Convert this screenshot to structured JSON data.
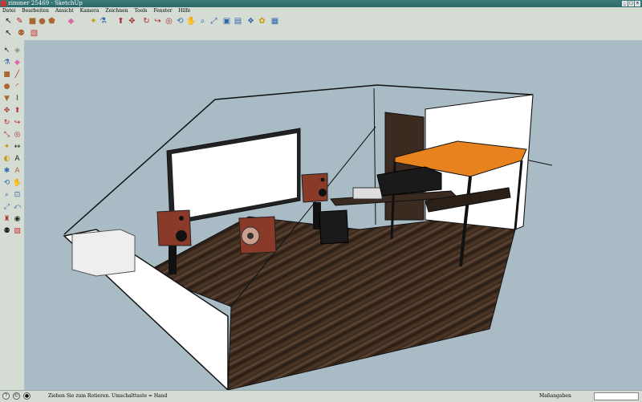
{
  "window": {
    "title": "zimmer 25469 - SketchUp"
  },
  "window_buttons": [
    "_",
    "□",
    "×"
  ],
  "menu": [
    "Datei",
    "Bearbeiten",
    "Ansicht",
    "Kamera",
    "Zeichnen",
    "Tools",
    "Fenster",
    "Hilfe"
  ],
  "toolbar_icons": [
    {
      "name": "select-icon",
      "glyph": "↖",
      "color": "#222"
    },
    {
      "name": "pencil-icon",
      "glyph": "✎",
      "color": "#b22"
    },
    {
      "name": "rectangle-icon",
      "glyph": "■",
      "color": "#a63"
    },
    {
      "name": "circle-icon",
      "glyph": "●",
      "color": "#a63"
    },
    {
      "name": "polygon-icon",
      "glyph": "⬟",
      "color": "#a63"
    },
    {
      "name": "eraser-icon",
      "glyph": "◆",
      "color": "#d6a"
    },
    {
      "name": "tape-measure-icon",
      "glyph": "✦",
      "color": "#c90"
    },
    {
      "name": "paint-bucket-icon",
      "glyph": "⚗",
      "color": "#36a"
    },
    {
      "name": "push-pull-icon",
      "glyph": "⬆",
      "color": "#a33"
    },
    {
      "name": "move-icon",
      "glyph": "✥",
      "color": "#a33"
    },
    {
      "name": "rotate-icon",
      "glyph": "↻",
      "color": "#b22"
    },
    {
      "name": "follow-me-icon",
      "glyph": "↪",
      "color": "#b22"
    },
    {
      "name": "offset-icon",
      "glyph": "◎",
      "color": "#a33"
    },
    {
      "name": "orbit-icon",
      "glyph": "⟲",
      "color": "#36a"
    },
    {
      "name": "pan-icon",
      "glyph": "✋",
      "color": "#222"
    },
    {
      "name": "zoom-icon",
      "glyph": "⌕",
      "color": "#36a"
    },
    {
      "name": "zoom-extents-icon",
      "glyph": "⤢",
      "color": "#36a"
    },
    {
      "name": "get-models-icon",
      "glyph": "▣",
      "color": "#36a"
    },
    {
      "name": "share-model-icon",
      "glyph": "▤",
      "color": "#36a"
    },
    {
      "name": "components-icon",
      "glyph": "❖",
      "color": "#36a"
    },
    {
      "name": "place-model-icon",
      "glyph": "✿",
      "color": "#c90"
    },
    {
      "name": "photo-texture-icon",
      "glyph": "▦",
      "color": "#36a"
    }
  ],
  "toolbar_row2_icons": [
    {
      "name": "select-small-icon",
      "glyph": "↖",
      "color": "#222"
    },
    {
      "name": "walk-icon",
      "glyph": "⚉",
      "color": "#a63"
    },
    {
      "name": "section-icon",
      "glyph": "▧",
      "color": "#c33"
    }
  ],
  "side_icons": [
    {
      "name": "select-tool-icon",
      "glyph": "↖",
      "color": "#222"
    },
    {
      "name": "make-component-icon",
      "glyph": "◈",
      "color": "#888"
    },
    {
      "name": "paint-tool-icon",
      "glyph": "⚗",
      "color": "#36a"
    },
    {
      "name": "eraser-tool-icon",
      "glyph": "◆",
      "color": "#d6a"
    },
    {
      "name": "rectangle-tool-icon",
      "glyph": "■",
      "color": "#a63"
    },
    {
      "name": "line-tool-icon",
      "glyph": "╱",
      "color": "#b22"
    },
    {
      "name": "circle-tool-icon",
      "glyph": "●",
      "color": "#a63"
    },
    {
      "name": "arc-tool-icon",
      "glyph": "◜",
      "color": "#b22"
    },
    {
      "name": "polygon-tool-icon",
      "glyph": "▼",
      "color": "#a63"
    },
    {
      "name": "freehand-tool-icon",
      "glyph": "⌇",
      "color": "#222"
    },
    {
      "name": "move-tool-icon",
      "glyph": "✥",
      "color": "#a33"
    },
    {
      "name": "push-pull-tool-icon",
      "glyph": "⬆",
      "color": "#a33"
    },
    {
      "name": "rotate-tool-icon",
      "glyph": "↻",
      "color": "#b22"
    },
    {
      "name": "follow-me-tool-icon",
      "glyph": "↪",
      "color": "#b22"
    },
    {
      "name": "scale-tool-icon",
      "glyph": "⤡",
      "color": "#a33"
    },
    {
      "name": "offset-tool-icon",
      "glyph": "◎",
      "color": "#a33"
    },
    {
      "name": "tape-tool-icon",
      "glyph": "✦",
      "color": "#c90"
    },
    {
      "name": "dimension-tool-icon",
      "glyph": "↔",
      "color": "#222"
    },
    {
      "name": "protractor-tool-icon",
      "glyph": "◐",
      "color": "#c90"
    },
    {
      "name": "text-tool-icon",
      "glyph": "A",
      "color": "#222"
    },
    {
      "name": "axes-tool-icon",
      "glyph": "✱",
      "color": "#36a"
    },
    {
      "name": "3d-text-tool-icon",
      "glyph": "A",
      "color": "#a63"
    },
    {
      "name": "orbit-tool-icon",
      "glyph": "⟲",
      "color": "#36a"
    },
    {
      "name": "pan-tool-icon",
      "glyph": "✋",
      "color": "#222"
    },
    {
      "name": "zoom-tool-icon",
      "glyph": "⌕",
      "color": "#36a"
    },
    {
      "name": "zoom-window-tool-icon",
      "glyph": "⊡",
      "color": "#36a"
    },
    {
      "name": "zoom-extents-tool-icon",
      "glyph": "⤢",
      "color": "#36a"
    },
    {
      "name": "previous-view-tool-icon",
      "glyph": "⤺",
      "color": "#36a"
    },
    {
      "name": "position-camera-tool-icon",
      "glyph": "♜",
      "color": "#a33"
    },
    {
      "name": "look-around-tool-icon",
      "glyph": "◉",
      "color": "#222"
    },
    {
      "name": "walk-tool-icon",
      "glyph": "⚉",
      "color": "#222"
    },
    {
      "name": "section-plane-tool-icon",
      "glyph": "▧",
      "color": "#c33"
    }
  ],
  "status": {
    "message": "Ziehen Sie zum Rotieren.  Umschalttaste = Hand",
    "measure_label": "Maßangaben",
    "icons": [
      {
        "name": "geo-location-icon",
        "glyph": "?"
      },
      {
        "name": "credits-icon",
        "glyph": "©"
      },
      {
        "name": "user-icon",
        "glyph": "●"
      }
    ]
  },
  "colors": {
    "sky": "#a9bcc5",
    "floor": "#3e2e22",
    "table_top": "#e8821e",
    "speaker": "#8a3a28",
    "wall": "#ffffff"
  }
}
